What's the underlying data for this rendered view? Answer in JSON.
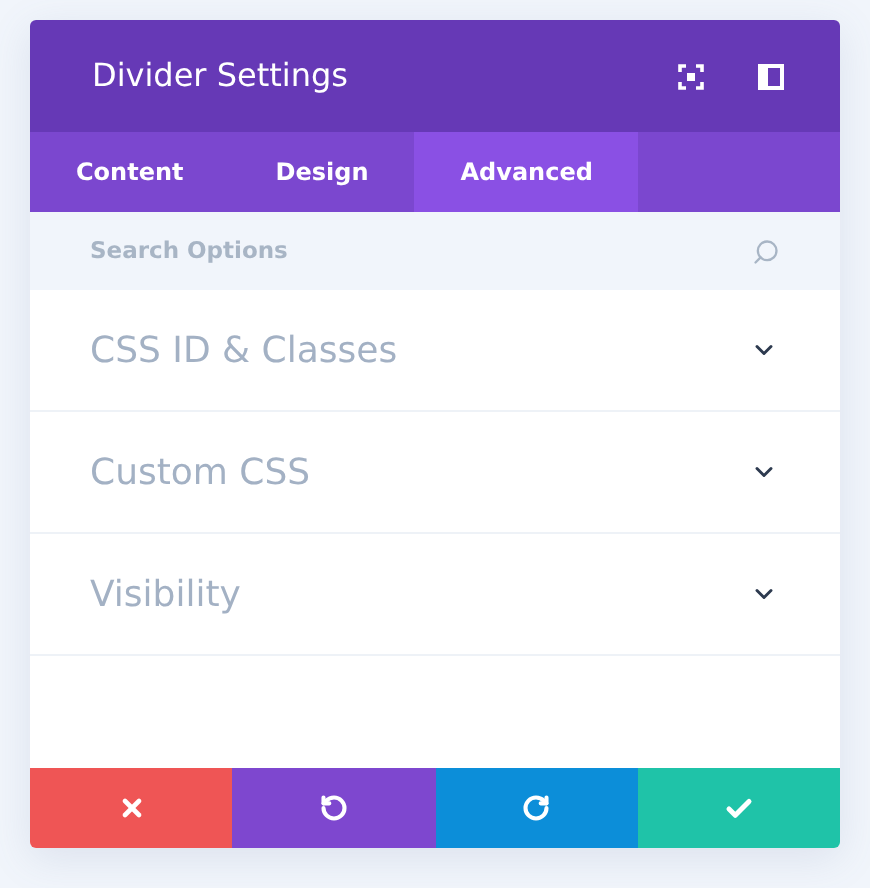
{
  "window": {
    "title": "Divider Settings"
  },
  "tabs": [
    {
      "label": "Content",
      "selected": false
    },
    {
      "label": "Design",
      "selected": false
    },
    {
      "label": "Advanced",
      "selected": true
    }
  ],
  "search": {
    "placeholder": "Search Options"
  },
  "sections": [
    {
      "label": "CSS ID & Classes",
      "expanded": false
    },
    {
      "label": "Custom CSS",
      "expanded": false
    },
    {
      "label": "Visibility",
      "expanded": false
    }
  ],
  "footer_buttons": [
    {
      "kind": "discard"
    },
    {
      "kind": "undo"
    },
    {
      "kind": "redo"
    },
    {
      "kind": "save"
    }
  ]
}
